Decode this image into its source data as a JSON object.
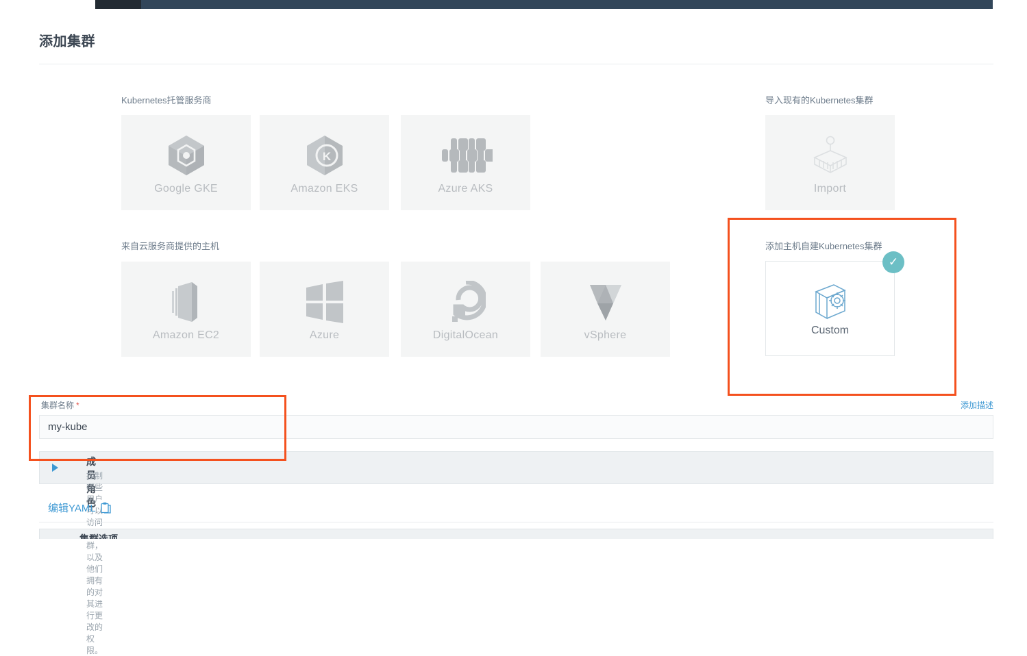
{
  "window": {
    "topbar_left_color": "#232b33",
    "topbar_right_color": "#32465a"
  },
  "page": {
    "title": "添加集群"
  },
  "sections": {
    "hosted_label": "Kubernetes托管服务商",
    "cloud_hosts_label": "来自云服务商提供的主机",
    "import_label": "导入现有的Kubernetes集群",
    "custom_label": "添加主机自建Kubernetes集群"
  },
  "providers": {
    "hosted": [
      {
        "id": "gke",
        "label": "Google GKE",
        "icon": "google-gke-icon"
      },
      {
        "id": "eks",
        "label": "Amazon EKS",
        "icon": "amazon-eks-icon"
      },
      {
        "id": "aks",
        "label": "Azure  AKS",
        "icon": "azure-aks-icon"
      }
    ],
    "cloud_hosts": [
      {
        "id": "ec2",
        "label": "Amazon EC2",
        "icon": "amazon-ec2-icon"
      },
      {
        "id": "azure",
        "label": "Azure",
        "icon": "azure-icon"
      },
      {
        "id": "do",
        "label": "DigitalOcean",
        "icon": "digitalocean-icon"
      },
      {
        "id": "vsphere",
        "label": "vSphere",
        "icon": "vsphere-icon"
      }
    ],
    "import": {
      "id": "import",
      "label": "Import",
      "icon": "import-container-icon"
    },
    "custom": {
      "id": "custom",
      "label": "Custom",
      "icon": "custom-box-gear-icon",
      "selected": true
    }
  },
  "form": {
    "name_label": "集群名称",
    "name_required_mark": "*",
    "name_value": "my-kube",
    "name_placeholder": "",
    "add_description_link": "添加描述"
  },
  "member_roles": {
    "title": "成员角色",
    "description": "控制哪些用户可以访问集群，以及他们拥有的对其进行更改的权限。"
  },
  "yaml": {
    "link_label": "编辑YAML",
    "icon": "clipboard-icon"
  },
  "cluster_options": {
    "title": "集群选项"
  },
  "colors": {
    "highlight": "#f4511e",
    "selected_check": "#6cbfc5",
    "link": "#3d98d3",
    "required": "#e2574c"
  }
}
